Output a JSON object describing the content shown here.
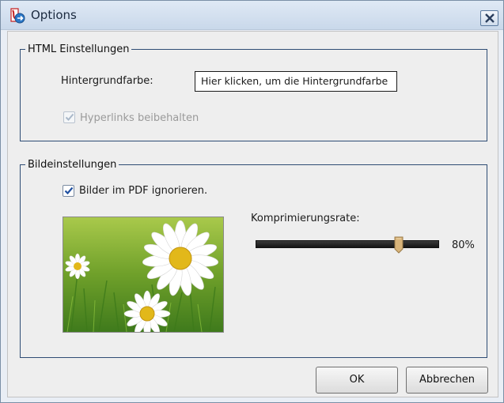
{
  "window": {
    "title": "Options"
  },
  "html_group": {
    "legend": "HTML Einstellungen",
    "background_label": "Hintergrundfarbe:",
    "background_value": "Hier klicken, um die Hintergrundfarbe",
    "hyperlinks_label": "Hyperlinks beibehalten",
    "hyperlinks_checked": true,
    "hyperlinks_enabled": false
  },
  "image_group": {
    "legend": "Bildeinstellungen",
    "ignore_images_label": "Bilder im PDF ignorieren.",
    "ignore_images_checked": true,
    "compression_label": "Komprimierungsrate:",
    "compression_value_text": "80%",
    "compression_value": 0.8
  },
  "buttons": {
    "ok": "OK",
    "cancel": "Abbrechen"
  },
  "icons": {
    "app": "pdf-converter-icon",
    "close": "close-icon",
    "check": "check-icon",
    "preview": "daisy-preview-image"
  }
}
